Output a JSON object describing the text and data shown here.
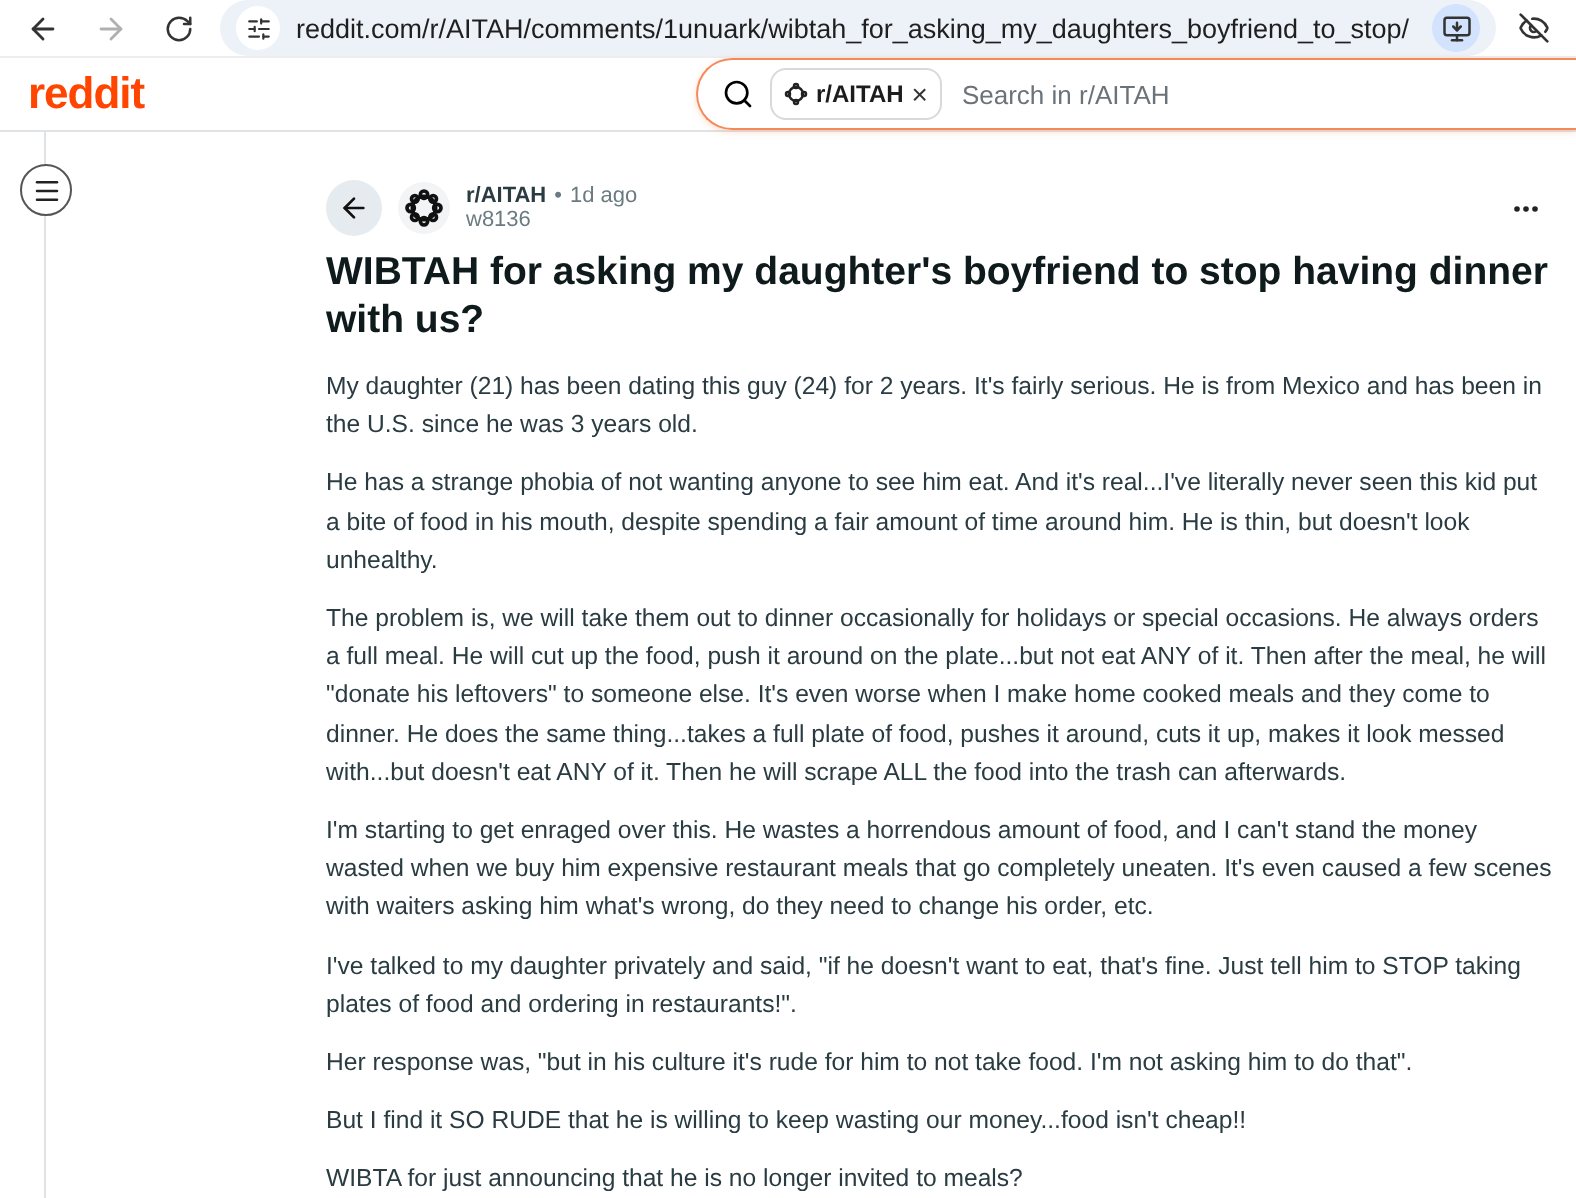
{
  "browser": {
    "url": "reddit.com/r/AITAH/comments/1unuark/wibtah_for_asking_my_daughters_boyfriend_to_stop/"
  },
  "header": {
    "logo": "reddit",
    "search": {
      "chip": "r/AITAH",
      "chip_close": "×",
      "placeholder": "Search in r/AITAH"
    }
  },
  "post": {
    "subreddit": "r/AITAH",
    "separator": "•",
    "age": "1d ago",
    "author": "w8136",
    "title": "WIBTAH for asking my daughter's boyfriend to stop having dinner with us?",
    "paragraphs": [
      "My daughter (21) has been dating this guy (24) for 2 years. It's fairly serious. He is from Mexico and has been in the U.S. since he was 3 years old.",
      "He has a strange phobia of not wanting anyone to see him eat. And it's real...I've literally never seen this kid put a bite of food in his mouth, despite spending a fair amount of time around him. He is thin, but doesn't look unhealthy.",
      "The problem is, we will take them out to dinner occasionally for holidays or special occasions. He always orders a full meal. He will cut up the food, push it around on the plate...but not eat ANY of it. Then after the meal, he will \"donate his leftovers\" to someone else. It's even worse when I make home cooked meals and they come to dinner. He does the same thing...takes a full plate of food, pushes it around, cuts it up, makes it look messed with...but doesn't eat ANY of it. Then he will scrape ALL the food into the trash can afterwards.",
      "I'm starting to get enraged over this. He wastes a horrendous amount of food, and I can't stand the money wasted when we buy him expensive restaurant meals that go completely uneaten. It's even caused a few scenes with waiters asking him what's wrong, do they need to change his order, etc.",
      "I've talked to my daughter privately and said, \"if he doesn't want to eat, that's fine. Just tell him to STOP taking plates of food and ordering in restaurants!\".",
      "Her response was, \"but in his culture it's rude for him to not take food. I'm not asking him to do that\".",
      "But I find it SO RUDE that he is willing to keep wasting our money...food isn't cheap!!",
      "WIBTA for just announcing that he is no longer invited to meals?"
    ]
  }
}
